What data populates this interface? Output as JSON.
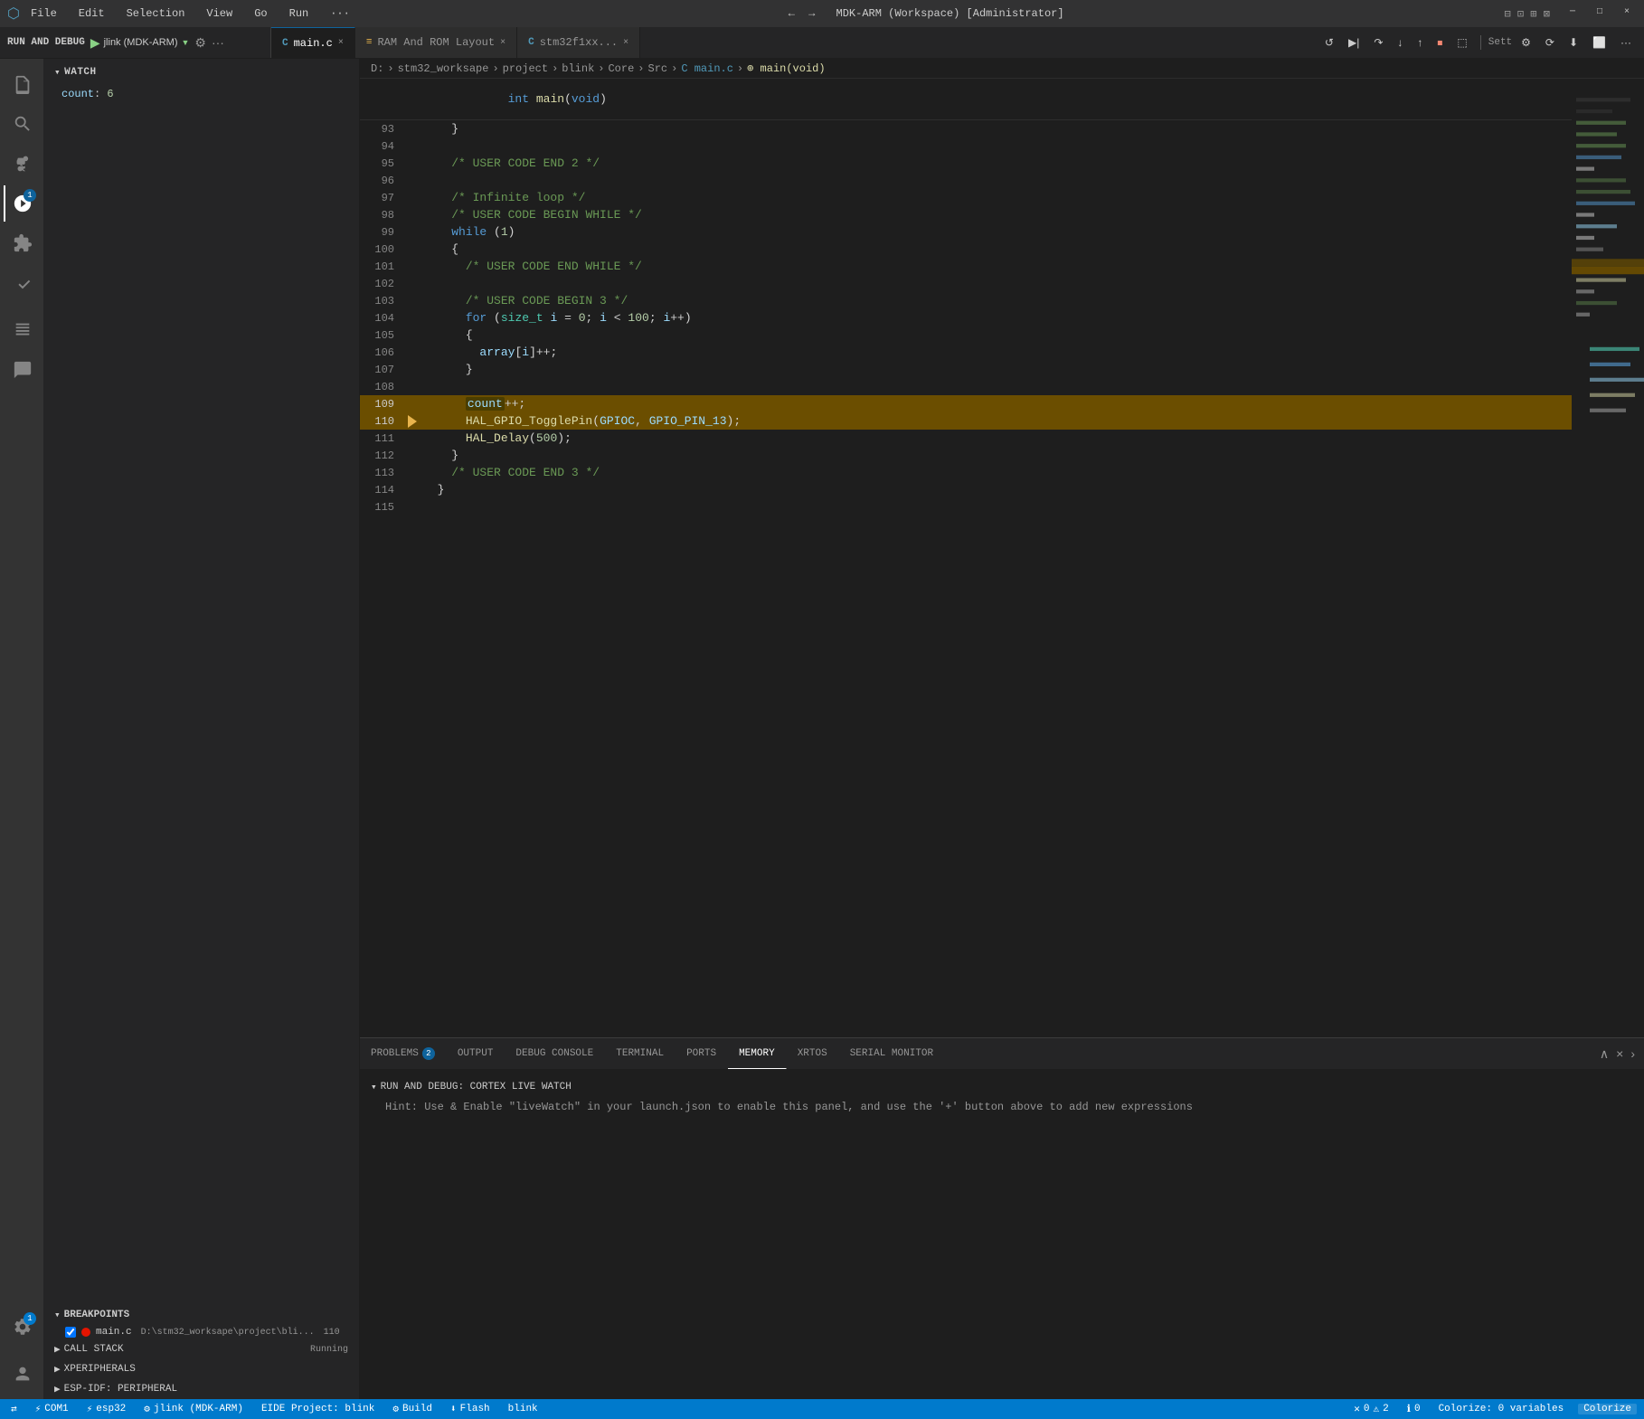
{
  "titlebar": {
    "icon": "⬡",
    "menu_items": [
      "File",
      "Edit",
      "Selection",
      "View",
      "Go",
      "Run",
      "..."
    ],
    "title": "MDK-ARM (Workspace) [Administrator]",
    "controls": [
      "─",
      "□",
      "×"
    ]
  },
  "debug_bar": {
    "label": "RUN AND DEBUG",
    "config": "jlink (MDK-ARM)",
    "gear_title": "Open launch.json",
    "more_title": "More actions"
  },
  "tabs": [
    {
      "id": "main-c",
      "icon": "C",
      "label": "main.c",
      "active": true,
      "modified": false
    },
    {
      "id": "ram-rom",
      "icon": "≡",
      "label": "RAM And ROM Layout",
      "active": false,
      "modified": false
    },
    {
      "id": "stm32f1xx",
      "icon": "C",
      "label": "stm32f1xx...",
      "active": false,
      "modified": false
    }
  ],
  "breadcrumb": {
    "items": [
      "D:",
      "stm32_worksape",
      "project",
      "blink",
      "Core",
      "Src",
      "main.c",
      "main(void)"
    ]
  },
  "debug_toolbar": {
    "buttons": [
      "▶",
      "⏸",
      "↻",
      "⬇",
      "⬆",
      "⬤",
      "↩"
    ]
  },
  "code": {
    "header_line": "int main(void)",
    "lines": [
      {
        "num": 93,
        "content": "    }",
        "type": "normal"
      },
      {
        "num": 94,
        "content": "",
        "type": "normal"
      },
      {
        "num": 95,
        "content": "    /* USER CODE END 2 */",
        "type": "comment"
      },
      {
        "num": 96,
        "content": "",
        "type": "normal"
      },
      {
        "num": 97,
        "content": "    /* Infinite loop */",
        "type": "comment"
      },
      {
        "num": 98,
        "content": "    /* USER CODE BEGIN WHILE */",
        "type": "comment"
      },
      {
        "num": 99,
        "content": "    while (1)",
        "type": "while"
      },
      {
        "num": 100,
        "content": "    {",
        "type": "normal"
      },
      {
        "num": 101,
        "content": "      /* USER CODE END WHILE */",
        "type": "comment"
      },
      {
        "num": 102,
        "content": "",
        "type": "normal"
      },
      {
        "num": 103,
        "content": "      /* USER CODE BEGIN 3 */",
        "type": "comment"
      },
      {
        "num": 104,
        "content": "      for (size_t i = 0; i < 100; i++)",
        "type": "for"
      },
      {
        "num": 105,
        "content": "      {",
        "type": "normal"
      },
      {
        "num": 106,
        "content": "        array[i]++;",
        "type": "normal"
      },
      {
        "num": 107,
        "content": "      }",
        "type": "normal"
      },
      {
        "num": 108,
        "content": "",
        "type": "normal"
      },
      {
        "num": 109,
        "content": "      count++;",
        "type": "highlighted"
      },
      {
        "num": 110,
        "content": "      HAL_GPIO_TogglePin(GPIOC, GPIO_PIN_13);",
        "type": "debug-current"
      },
      {
        "num": 111,
        "content": "      HAL_Delay(500);",
        "type": "normal"
      },
      {
        "num": 112,
        "content": "    }",
        "type": "normal"
      },
      {
        "num": 113,
        "content": "    /* USER CODE END 3 */",
        "type": "comment"
      },
      {
        "num": 114,
        "content": "  }",
        "type": "normal"
      },
      {
        "num": 115,
        "content": "",
        "type": "normal"
      }
    ]
  },
  "watch": {
    "label": "WATCH",
    "items": [
      {
        "name": "count",
        "value": "6"
      }
    ]
  },
  "breakpoints": {
    "label": "BREAKPOINTS",
    "items": [
      {
        "file": "main.c",
        "path": "D:\\stm32_worksape\\project\\bli...",
        "line": "110"
      }
    ]
  },
  "callstack": {
    "label": "CALL STACK",
    "status": "Running"
  },
  "xperipherals": {
    "label": "XPERIPHERALS"
  },
  "esp_idf": {
    "label": "ESP-IDF: PERIPHERAL"
  },
  "panel": {
    "tabs": [
      {
        "id": "problems",
        "label": "PROBLEMS",
        "badge": "2"
      },
      {
        "id": "output",
        "label": "OUTPUT"
      },
      {
        "id": "debug-console",
        "label": "DEBUG CONSOLE"
      },
      {
        "id": "terminal",
        "label": "TERMINAL"
      },
      {
        "id": "ports",
        "label": "PORTS"
      },
      {
        "id": "memory",
        "label": "MEMORY",
        "active": true
      },
      {
        "id": "xrtos",
        "label": "XRTOS"
      },
      {
        "id": "serial-monitor",
        "label": "SERIAL MONITOR"
      }
    ],
    "section_label": "RUN AND DEBUG: CORTEX LIVE WATCH",
    "hint": "Hint: Use & Enable \"liveWatch\" in your launch.json to enable this panel, and use the '+' button above to add new expressions"
  },
  "statusbar": {
    "left_items": [
      {
        "id": "source-control",
        "icon": "⎇",
        "text": "COM1"
      },
      {
        "id": "esp32",
        "icon": "⚡",
        "text": "esp32"
      },
      {
        "id": "jlink",
        "icon": "⚙",
        "text": "jlink (MDK-ARM)"
      },
      {
        "id": "eide",
        "text": "EIDE Project: blink"
      },
      {
        "id": "build",
        "icon": "🔨",
        "text": "Build"
      },
      {
        "id": "flash",
        "icon": "⬇",
        "text": "Flash"
      },
      {
        "id": "blink",
        "text": "blink"
      }
    ],
    "right_items": [
      {
        "id": "errors",
        "icon": "✕",
        "text": "0",
        "class": "error"
      },
      {
        "id": "warnings",
        "icon": "⚠",
        "text": "2",
        "class": "warn"
      },
      {
        "id": "info",
        "icon": "ℹ",
        "text": "0"
      },
      {
        "id": "colorize",
        "text": "Colorize: 0 variables"
      },
      {
        "id": "colorize-btn",
        "text": "Colorize"
      }
    ]
  }
}
